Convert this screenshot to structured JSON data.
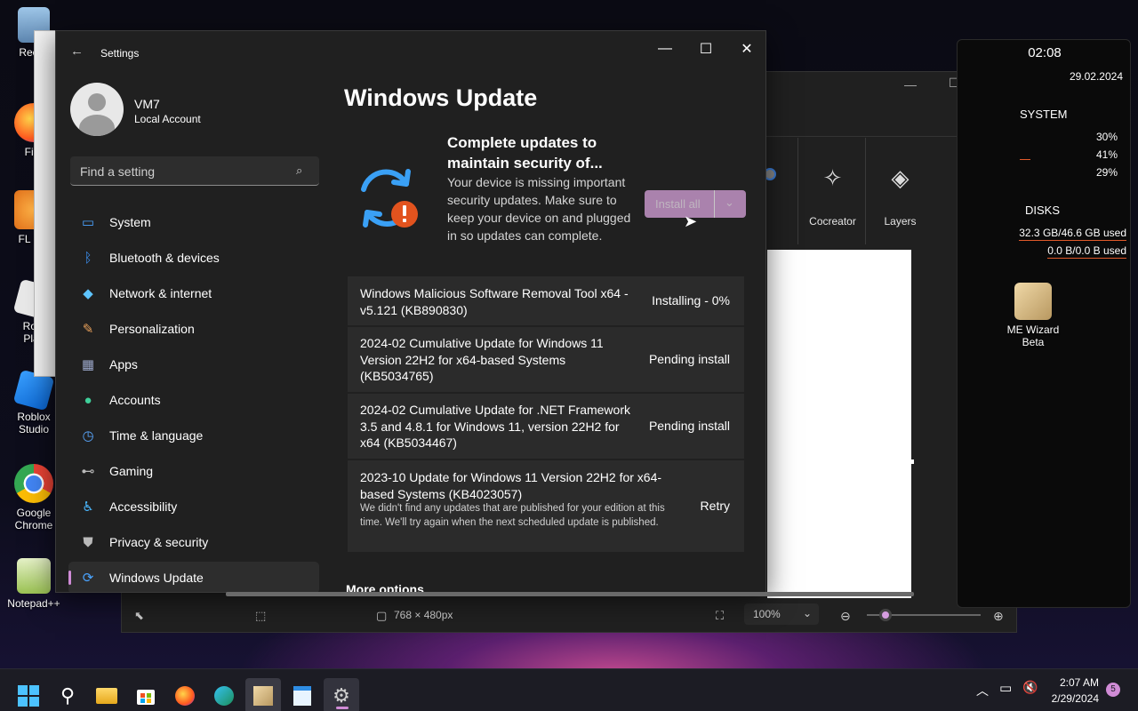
{
  "desktop": {
    "icons": [
      {
        "label": "Recyc"
      },
      {
        "label": "Fire"
      },
      {
        "label": "FL Stu"
      },
      {
        "label": "Robl Play"
      },
      {
        "label": "Roblox Studio"
      },
      {
        "label": "Google Chrome"
      },
      {
        "label": "Notepad++"
      },
      {
        "label": "ME Wizard Beta"
      }
    ]
  },
  "widget": {
    "time": "02:08",
    "date": "29.02.2024",
    "system_title": "SYSTEM",
    "cpu": "30%",
    "ram": "41%",
    "gpu": "29%",
    "disks_title": "DISKS",
    "disk1": "32.3 GB/46.6 GB used",
    "disk2": "0.0 B/0.0 B used"
  },
  "paint": {
    "tools": [
      {
        "label": "Cocreator",
        "icon": "sparkle-icon"
      },
      {
        "label": "Layers",
        "icon": "layers-icon"
      }
    ],
    "canvas_size": "768 × 480px",
    "zoom": "100%"
  },
  "settings": {
    "app_title": "Settings",
    "user": {
      "name": "VM7",
      "account_type": "Local Account"
    },
    "search": {
      "placeholder": "Find a setting"
    },
    "nav": [
      {
        "label": "System",
        "icon": "system-icon",
        "color": "#4aa3ff"
      },
      {
        "label": "Bluetooth & devices",
        "icon": "bluetooth-icon",
        "color": "#3b8ff0"
      },
      {
        "label": "Network & internet",
        "icon": "wifi-icon",
        "color": "#5ec4ff"
      },
      {
        "label": "Personalization",
        "icon": "brush-icon",
        "color": "#e8a05a"
      },
      {
        "label": "Apps",
        "icon": "apps-icon",
        "color": "#9aa6c8"
      },
      {
        "label": "Accounts",
        "icon": "accounts-icon",
        "color": "#3fcf9a"
      },
      {
        "label": "Time & language",
        "icon": "clock-globe-icon",
        "color": "#5aa8ff"
      },
      {
        "label": "Gaming",
        "icon": "gamepad-icon",
        "color": "#b9b9b9"
      },
      {
        "label": "Accessibility",
        "icon": "accessibility-icon",
        "color": "#4ab8ff"
      },
      {
        "label": "Privacy & security",
        "icon": "shield-icon",
        "color": "#b9b9b9"
      },
      {
        "label": "Windows Update",
        "icon": "update-icon",
        "color": "#4aa3ff",
        "active": true
      }
    ],
    "page_title": "Windows Update",
    "banner": {
      "heading": "Complete updates to maintain security of...",
      "body": "Your device is missing important security updates. Make sure to keep your device on and plugged in so updates can complete.",
      "button_label": "Install all"
    },
    "updates": [
      {
        "name": "Windows Malicious Software Removal Tool x64 - v5.121 (KB890830)",
        "status": "Installing - 0%"
      },
      {
        "name": "2024-02 Cumulative Update for Windows 11 Version 22H2 for x64-based Systems (KB5034765)",
        "status": "Pending install"
      },
      {
        "name": "2024-02 Cumulative Update for .NET Framework 3.5 and 4.8.1 for Windows 11, version 22H2 for x64 (KB5034467)",
        "status": "Pending install"
      },
      {
        "name": "2023-10 Update for Windows 11 Version 22H2 for x64-based Systems (KB4023057)",
        "status": "Retry",
        "description": "We didn't find any updates that are published for your edition at this time. We'll try again when the next scheduled update is published."
      }
    ],
    "more_options": "More options"
  },
  "taskbar": {
    "time": "2:07 AM",
    "date": "2/29/2024",
    "notification_count": "5"
  }
}
